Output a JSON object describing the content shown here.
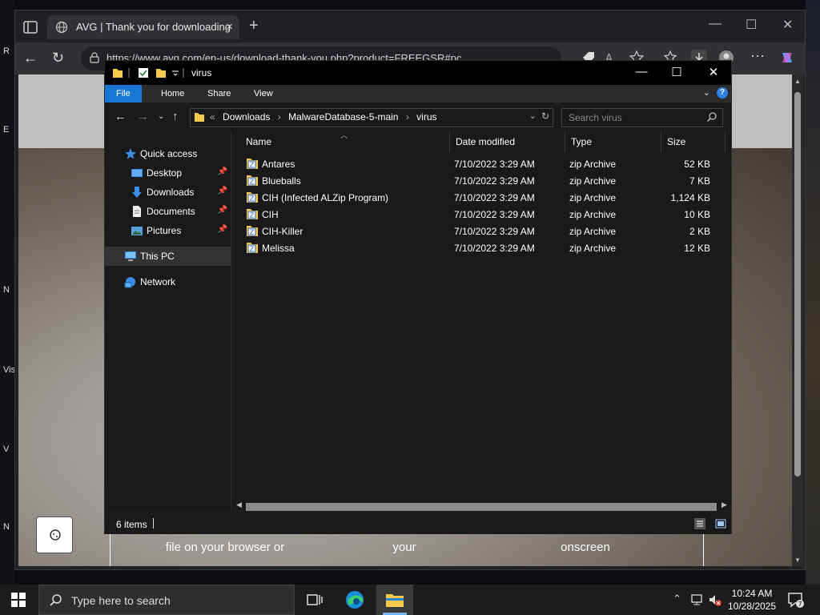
{
  "desktop": {
    "fragments": [
      "R",
      "E",
      "N",
      "Vis",
      "V",
      "N"
    ]
  },
  "browser": {
    "tab_title": "AVG | Thank you for downloading",
    "tab_close": "×",
    "new_tab": "+",
    "url": "https://www.avg.com/en-us/download-thank-you.php?product=FREEGSR#pc",
    "window_controls": [
      "—",
      "☐",
      "✕"
    ],
    "page_bottom_texts": [
      "file on your browser or",
      "your",
      "onscreen"
    ]
  },
  "explorer": {
    "window_title": "virus",
    "window_controls": [
      "—",
      "☐",
      "✕"
    ],
    "ribbon_tabs": [
      "File",
      "Home",
      "Share",
      "View"
    ],
    "breadcrumb_prefix": "«",
    "breadcrumbs": [
      "Downloads",
      "MalwareDatabase-5-main",
      "virus"
    ],
    "search_placeholder": "Search virus",
    "nav_pane": [
      {
        "label": "Quick access",
        "icon": "star-icon",
        "pinned": false
      },
      {
        "label": "Desktop",
        "icon": "desktop-folder-icon",
        "pinned": true
      },
      {
        "label": "Downloads",
        "icon": "download-arrow-icon",
        "pinned": true
      },
      {
        "label": "Documents",
        "icon": "documents-icon",
        "pinned": true
      },
      {
        "label": "Pictures",
        "icon": "pictures-icon",
        "pinned": true
      },
      {
        "label": "This PC",
        "icon": "computer-icon",
        "pinned": false,
        "selected": true
      },
      {
        "label": "Network",
        "icon": "network-icon",
        "pinned": false
      }
    ],
    "columns": [
      "Name",
      "Date modified",
      "Type",
      "Size"
    ],
    "files": [
      {
        "name": "Antares",
        "date": "7/10/2022 3:29 AM",
        "type": "zip Archive",
        "size": "52 KB"
      },
      {
        "name": "Blueballs",
        "date": "7/10/2022 3:29 AM",
        "type": "zip Archive",
        "size": "7 KB"
      },
      {
        "name": "CIH (Infected ALZip Program)",
        "date": "7/10/2022 3:29 AM",
        "type": "zip Archive",
        "size": "1,124 KB"
      },
      {
        "name": "CIH",
        "date": "7/10/2022 3:29 AM",
        "type": "zip Archive",
        "size": "10 KB"
      },
      {
        "name": "CIH-Killer",
        "date": "7/10/2022 3:29 AM",
        "type": "zip Archive",
        "size": "2 KB"
      },
      {
        "name": "Melissa",
        "date": "7/10/2022 3:29 AM",
        "type": "zip Archive",
        "size": "12 KB"
      }
    ],
    "status_items": "6 items"
  },
  "taskbar": {
    "search_placeholder": "Type here to search",
    "time": "10:24 AM",
    "date": "10/28/2025",
    "notification_count": "7"
  },
  "colors": {
    "accent": "#1976d2",
    "explorer_bg": "#191919",
    "folder_yellow": "#f4c94c"
  }
}
